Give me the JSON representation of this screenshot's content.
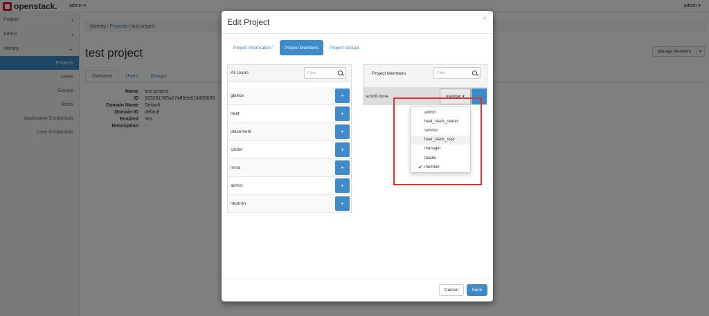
{
  "topbar": {
    "brand": "openstack.",
    "project_selector": "admin ▾",
    "user_menu": "admin ▾"
  },
  "sidebar": {
    "sections": [
      {
        "label": "Project"
      },
      {
        "label": "Admin"
      },
      {
        "label": "Identity"
      }
    ],
    "identity_items": [
      {
        "label": "Projects"
      },
      {
        "label": "Users"
      },
      {
        "label": "Groups"
      },
      {
        "label": "Roles"
      },
      {
        "label": "Application Credentials"
      },
      {
        "label": "User Credentials"
      }
    ]
  },
  "breadcrumb": {
    "item1": "Identity",
    "sep1": "/",
    "item2": "Projects",
    "sep2": "/",
    "item3": "test project"
  },
  "page": {
    "title": "test project",
    "manage_members": "Manage Members",
    "manage_caret": "▾",
    "tabs": [
      {
        "label": "Overview"
      },
      {
        "label": "Users"
      },
      {
        "label": "Groups"
      }
    ],
    "details": [
      {
        "k": "Name",
        "v": "test project"
      },
      {
        "k": "ID",
        "v": "153261785a17485eb614893699"
      },
      {
        "k": "Domain Name",
        "v": "Default"
      },
      {
        "k": "Domain ID",
        "v": "default"
      },
      {
        "k": "Enabled",
        "v": "Yes"
      },
      {
        "k": "Description",
        "v": "-"
      }
    ]
  },
  "modal": {
    "title": "Edit Project",
    "close": "×",
    "tabs": [
      {
        "label": "Project Information"
      },
      {
        "label": "Project Members"
      },
      {
        "label": "Project Groups"
      }
    ],
    "required_marker": "*",
    "all_users": {
      "title": "All Users",
      "filter_placeholder": "Filter",
      "users": [
        "glance",
        "heat",
        "placement",
        "cinder",
        "nova",
        "admin",
        "neutron"
      ],
      "add_label": "+"
    },
    "project_members": {
      "title": "Project Members",
      "filter_placeholder": "Filter",
      "member": "sushil.more",
      "role_button": "member ▾"
    },
    "role_dropdown": {
      "options": [
        "admin",
        "heat_stack_owner",
        "service",
        "heat_stack_user",
        "manager",
        "reader",
        "member"
      ],
      "selected": "member",
      "check_mark": "✔"
    },
    "cancel": "Cancel",
    "save": "Save"
  }
}
